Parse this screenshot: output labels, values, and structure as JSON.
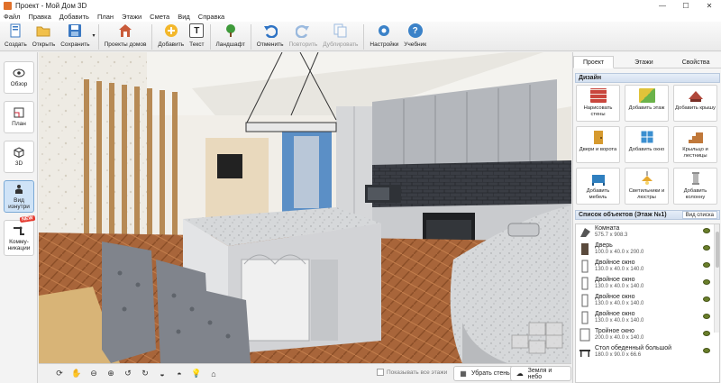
{
  "window": {
    "title": "Проект - Мой Дом 3D",
    "controls": [
      "—",
      "☐",
      "✕"
    ]
  },
  "menu": [
    "Файл",
    "Правка",
    "Добавить",
    "План",
    "Этажи",
    "Смета",
    "Вид",
    "Справка"
  ],
  "toolbar": {
    "create": "Создать",
    "open": "Открыть",
    "save": "Сохранить",
    "house_projects": "Проекты домов",
    "add": "Добавить",
    "text": "Текст",
    "landscape": "Ландшафт",
    "undo": "Отменить",
    "redo": "Повторить",
    "duplicate": "Дублировать",
    "settings": "Настройки",
    "tutorial": "Учебник"
  },
  "left_panel": {
    "overview": "Обзор",
    "plan": "План",
    "view3d": "3D",
    "view_inside": "Вид изнутри",
    "new_badge": "NEW",
    "communications": "Комму-никации"
  },
  "bottom": {
    "show_all_floors": "Показывать все этажи",
    "remove_walls": "Убрать стены",
    "ground_sky": "Земля и небо"
  },
  "right_panel": {
    "tabs": [
      "Проект",
      "Этажи",
      "Свойства"
    ],
    "active_tab": "Проект",
    "design_header": "Дизайн",
    "design_buttons": [
      {
        "label": "Нарисовать стены",
        "icon": "brick-wall-icon",
        "color": "#c9463d"
      },
      {
        "label": "Добавить этаж",
        "icon": "add-floor-icon",
        "color": "#e0c33a"
      },
      {
        "label": "Добавить крышу",
        "icon": "roof-icon",
        "color": "#b0473a"
      },
      {
        "label": "Двери и ворота",
        "icon": "door-icon",
        "color": "#d69a2f"
      },
      {
        "label": "Добавить окно",
        "icon": "window-icon",
        "color": "#3b8fd0"
      },
      {
        "label": "Крыльцо и лестницы",
        "icon": "stairs-icon",
        "color": "#c0783a"
      },
      {
        "label": "Добавить мебель",
        "icon": "furniture-icon",
        "color": "#2f7fbf"
      },
      {
        "label": "Светильники и люстры",
        "icon": "lamp-icon",
        "color": "#e6a82e"
      },
      {
        "label": "Добавить колонну",
        "icon": "column-icon",
        "color": "#8e8e8e"
      }
    ],
    "objects_header": "Список объектов (Этаж №1)",
    "view_list": "Вид списка",
    "objects": [
      {
        "name": "Комната",
        "dims": "575.7 x 908.3",
        "icon": "room-icon"
      },
      {
        "name": "Дверь",
        "dims": "100.0 x 40.0 x 200.0",
        "icon": "door-icon"
      },
      {
        "name": "Двойное окно",
        "dims": "130.0 x 40.0 x 140.0",
        "icon": "window-icon"
      },
      {
        "name": "Двойное окно",
        "dims": "130.0 x 40.0 x 140.0",
        "icon": "window-icon"
      },
      {
        "name": "Двойное окно",
        "dims": "130.0 x 40.0 x 140.0",
        "icon": "window-icon"
      },
      {
        "name": "Двойное окно",
        "dims": "130.0 x 40.0 x 140.0",
        "icon": "window-icon"
      },
      {
        "name": "Тройное окно",
        "dims": "200.0 x 40.0 x 140.0",
        "icon": "window-icon"
      },
      {
        "name": "Стол обеденный большой",
        "dims": "180.0 x 90.0 x 66.6",
        "icon": "table-icon"
      }
    ]
  }
}
